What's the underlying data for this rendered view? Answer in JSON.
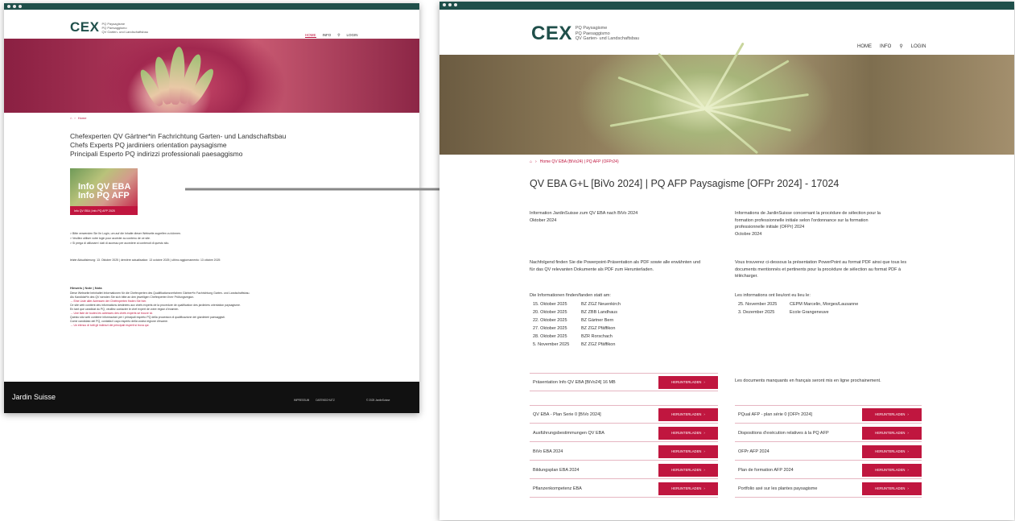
{
  "left_page": {
    "logo_text": "CEX",
    "logo_sub": [
      "PQ Paysagisme",
      "PQ Paesaggismo",
      "QV Garten- und Landschaftsbau"
    ],
    "nav": [
      "HOME",
      "INFO",
      "LOGIN"
    ],
    "breadcrumb": "Home",
    "titles": [
      "Chefexperten QV Gärtner*in Fachrichtung Garten- und Landschaftsbau",
      "Chefs Experts PQ jardiniers orientation paysagisme",
      "Principali Esperto PQ indirizzi professionali paesaggismo"
    ],
    "tile": {
      "line1": "Info QV EBA",
      "line2": "Info PQ AFP",
      "band": "Info QV EBA | Info PQ AFP 2025"
    },
    "notes": [
      "> Bitte verwenden Sie Ihr Login, um auf die Inhalte dieser Webseite zugreifen zu können.",
      "> Veuillez utiliser votre login pour accéder au contenu de ce site.",
      "> Si prega di utilizzare i dati di accesso per accedere ai contenuti di questo sito."
    ],
    "updated": "letzte Aktualisierung: 13. Oktober 2025 | dernière actualisation: 13 octobre 2025 | ultimo aggiornamento: 13 ottobre 2025",
    "hinweis_title": "Hinweis | Note | Nota",
    "hinweis_lines": [
      "Diese Webseite beinhaltet Informationen für die Chefexperten des Qualifikationsverfahren Gärtner*in Fachrichtung Garten- und Landschaftsbau.",
      "Als Kandidat*in des QV wenden Sie sich bitte an den jeweiligen Chefexperten Ihrer Prüfungsregion.",
      "→ Eine Liste aller Adressen der Chefexperten finden Sie hier.",
      "Ce site web contient des informations destinées aux chefs experts de la procédure de qualification des jardiniers orientation paysagisme.",
      "En tant que candidat du PQ, veuillez contacter le chef expert de votre région d'examen.",
      "→ Une liste de toutes les adresses des chefs experts se trouve ici.",
      "Questo sito web contiene informazioni per i principali esperto PQ della procedura di qualificazione dei giardinieri paesaggisti.",
      "Come candidato del PQ, contatta il capo esperto della vostra regione d'esame.",
      "→ Un elenco di tutti gli indirizzi dei principali esperti si trova qui."
    ],
    "footer_brand": "Jardin Suisse",
    "footer_links": [
      "IMPRESSUM",
      "DATENSCHUTZ"
    ],
    "footer_copy": "© 2025 JardinSuisse"
  },
  "right_page": {
    "logo_text": "CEX",
    "logo_sub": [
      "PQ Paysagisme",
      "PQ Paesaggismo",
      "QV Garten- und Landschaftsbau"
    ],
    "nav": [
      "HOME",
      "INFO",
      "LOGIN"
    ],
    "breadcrumb": "Home QV EBA (BiVo24) | PQ AFP (OFPr24)",
    "title": "QV EBA G+L [BiVo 2024] | PQ AFP Paysagisme [OFPr 2024] - 17024",
    "de_heading": [
      "Information JardinSuisse zum QV EBA nach BiVo 2024",
      "Oktober 2024"
    ],
    "fr_heading": [
      "Informations de JardinSuisse concernant la procédure de sélection pour la",
      "formation professionnelle initiale selon l'ordonnance sur la formation",
      "professionnelle initiale (OFPr) 2024",
      "Octobre 2024"
    ],
    "de_intro": [
      "Nachfolgend finden Sie die Powerpoint-Präsentation als PDF sowie alle erwähnten und",
      "für das QV relevanten Dokumente als PDF zum Herunterladen."
    ],
    "fr_intro": [
      "Vous trouverez ci-dessous la présentation PowerPoint au format PDF ainsi que tous les",
      "documents mentionnés et pertinents pour la procédure de sélection au format PDF à",
      "télécharger."
    ],
    "de_dates_label": "Die Informationen finden/fanden statt am:",
    "fr_dates_label": "Les informations ont lieu/ont eu lieu le:",
    "de_dates": [
      [
        "15. Oktober 2025",
        "BZ ZGZ Neuenkirch"
      ],
      [
        "20. Oktober 2025",
        "BZ ZBB Landhaus"
      ],
      [
        "22. Oktober 2025",
        "BZ Gärtner Bern"
      ],
      [
        "27. Oktober 2025",
        "BZ ZGZ Pfäffikon"
      ],
      [
        "28. Oktober 2025",
        "BZR Rorschach"
      ],
      [
        "5. November 2025",
        "BZ ZGZ Pfäffikon"
      ]
    ],
    "fr_dates": [
      [
        "25. November 2025",
        "CEPM Marcelin, Morges/Lausanne"
      ],
      [
        "3. Dezember 2025",
        "Ecole Grangeneuve"
      ]
    ],
    "presentation": "Präsentation Info QV EBA [BiVo24] 16 MB",
    "fr_note": "Les documents manquants en français seront mis en ligne prochainement.",
    "download_label": "HERUNTERLADEN",
    "de_docs": [
      "QV EBA - Plan Serie 0 [BiVo 2024]",
      "Ausführungsbestimmungen QV EBA",
      "BiVo EBA 2024",
      "Bildungsplan EBA 2024",
      "Pflanzenkompetenz EBA"
    ],
    "fr_docs": [
      "PQual AFP - plan série 0 [OFPr 2024]",
      "Dispositions d'exécution relatives à la PQ AFP",
      "OFPr AFP 2024",
      "Plan de formation AFP 2024",
      "Portfolio axé sur les plantes paysagisme"
    ]
  }
}
